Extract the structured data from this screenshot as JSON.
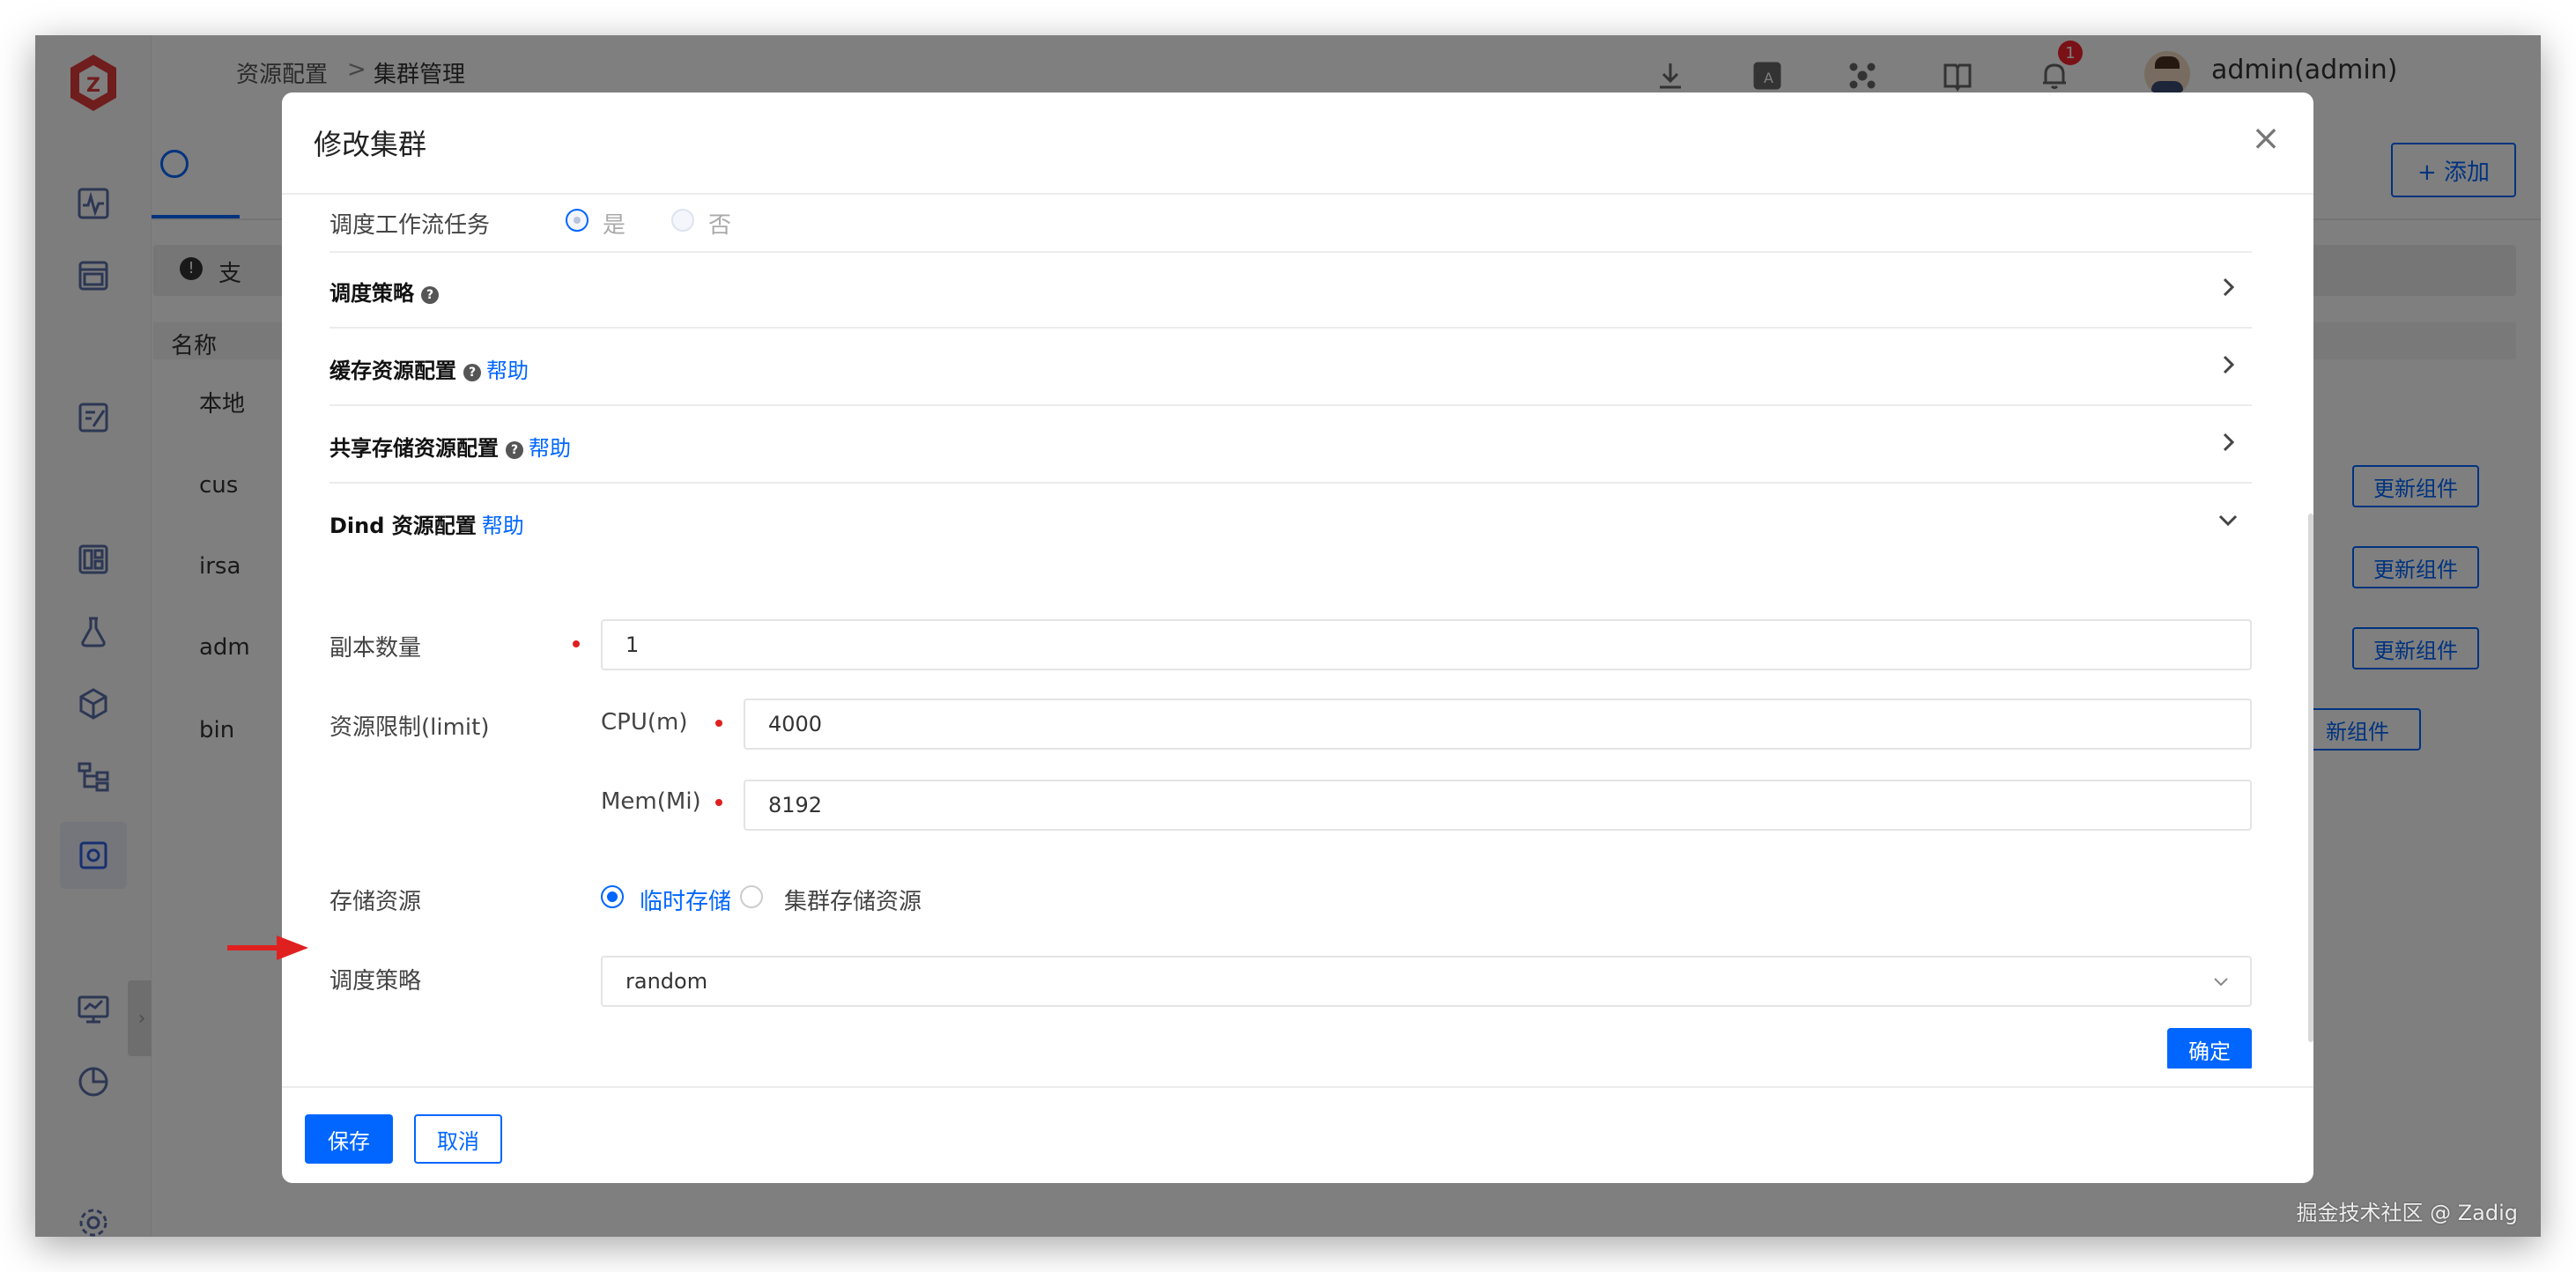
{
  "breadcrumb": {
    "parent": "资源配置",
    "sep": ">",
    "current": "集群管理"
  },
  "user": {
    "name": "admin(admin)"
  },
  "notifications": {
    "count": "1"
  },
  "top_actions": {
    "add_label": "+ 添加"
  },
  "background": {
    "notice_prefix": "支",
    "table_header_name": "名称",
    "rows": [
      {
        "name": "本地"
      },
      {
        "name": "cus"
      },
      {
        "name": "irsa"
      },
      {
        "name": "adm"
      },
      {
        "name": "bin"
      }
    ],
    "update_label": "更新组件",
    "update_label_partial": "新组件"
  },
  "modal": {
    "title": "修改集群",
    "close_label": "×",
    "workflow_task": {
      "label": "调度工作流任务",
      "yes": "是",
      "no": "否"
    },
    "sections": {
      "schedule_policy": "调度策略",
      "cache_resource": "缓存资源配置",
      "shared_storage": "共享存储资源配置",
      "dind": "Dind 资源配置",
      "help": "帮助",
      "help_q": "?"
    },
    "dind": {
      "replicas_label": "副本数量",
      "replicas_value": "1",
      "limit_label": "资源限制(limit)",
      "cpu_label": "CPU(m)",
      "cpu_value": "4000",
      "mem_label": "Mem(Mi)",
      "mem_value": "8192",
      "storage_label": "存储资源",
      "storage_temp": "临时存储",
      "storage_cluster": "集群存储资源",
      "policy_label": "调度策略",
      "policy_value": "random",
      "confirm_label": "确定"
    },
    "footer": {
      "save_label": "保存",
      "cancel_label": "取消"
    }
  },
  "watermark": "掘金技术社区 @ Zadig",
  "colors": {
    "primary": "#0066ff",
    "required": "#e02020",
    "arrow": "#e0201f"
  }
}
